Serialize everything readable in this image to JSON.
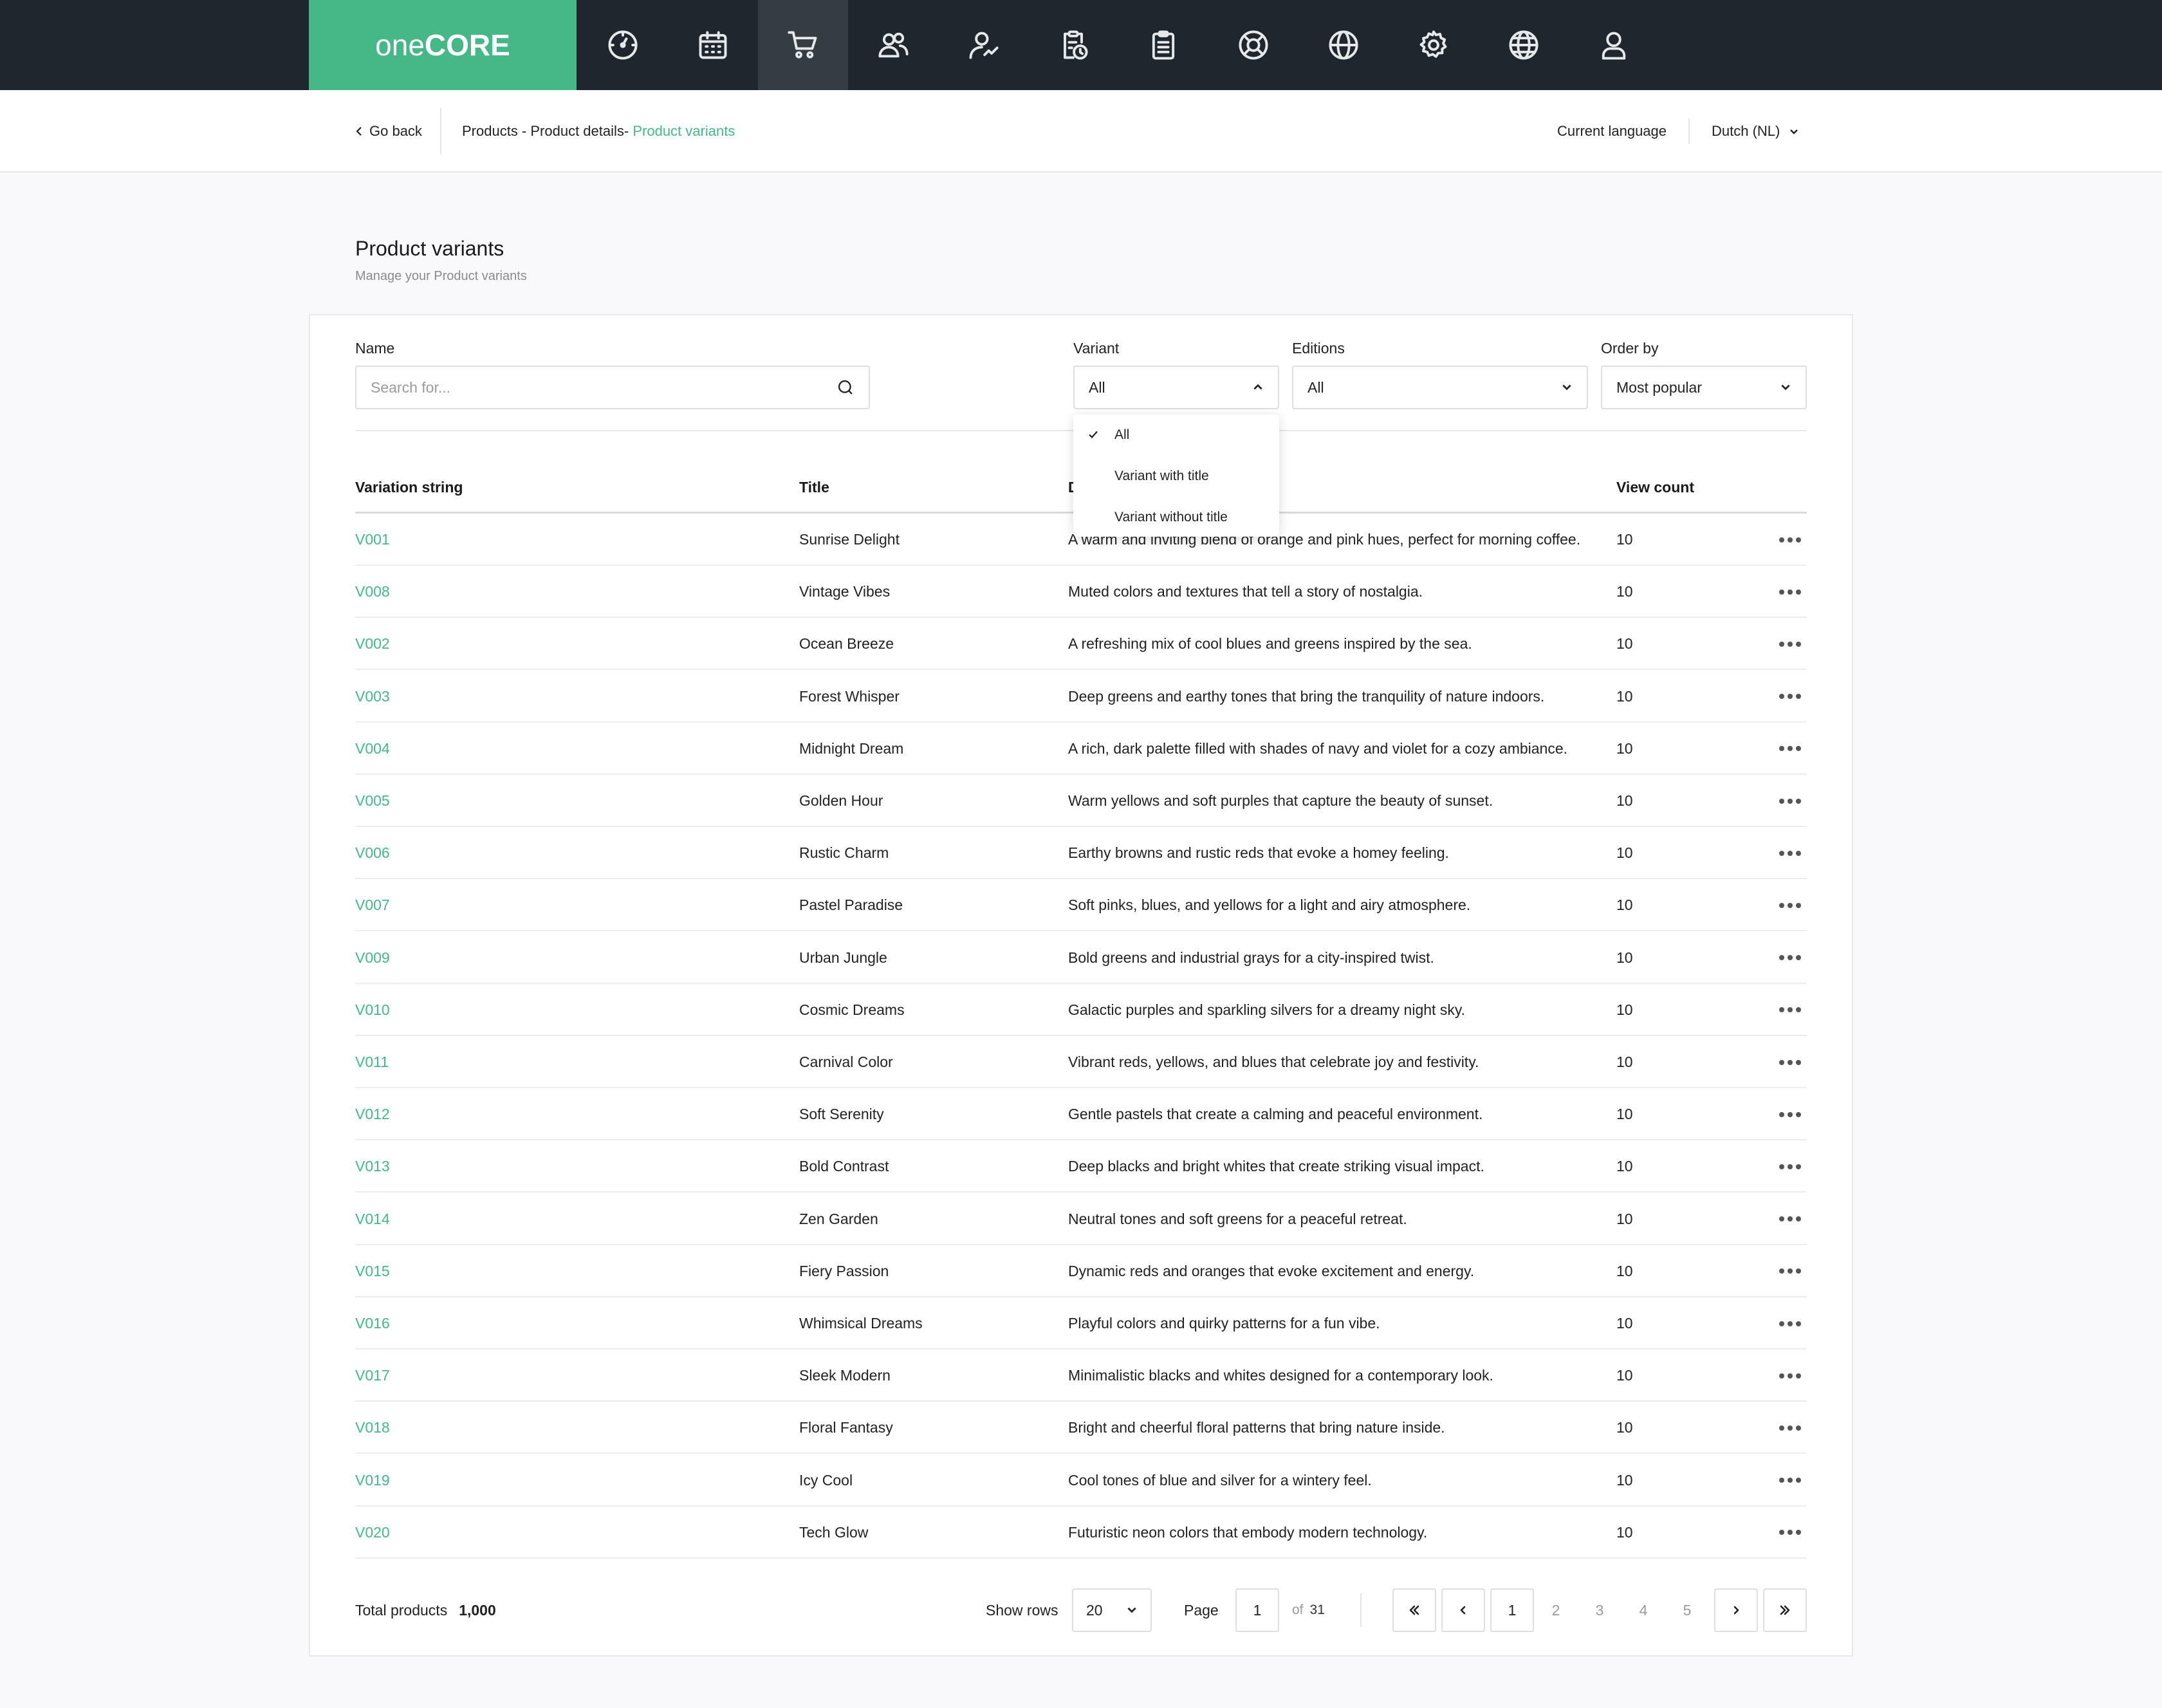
{
  "logo": {
    "prefix": "one",
    "suffix": "CORE"
  },
  "nav": {
    "icons": [
      "dashboard-icon",
      "calendar-icon",
      "cart-icon",
      "users-icon",
      "user-chart-icon",
      "clipboard-clock-icon",
      "clipboard-icon",
      "support-icon",
      "globe-icon",
      "gear-icon",
      "globe-grid-icon",
      "user-icon"
    ],
    "active": "cart-icon"
  },
  "subheader": {
    "go_back": "Go back",
    "breadcrumb": {
      "part1": "Products - ",
      "part2": "Product details- ",
      "current": "Product variants"
    },
    "current_language_label": "Current language",
    "language_value": "Dutch (NL)"
  },
  "page": {
    "title": "Product variants",
    "subtitle": "Manage your Product variants"
  },
  "filters": {
    "name_label": "Name",
    "name_placeholder": "Search for...",
    "variant_label": "Variant",
    "variant_value": "All",
    "editions_label": "Editions",
    "editions_value": "All",
    "orderby_label": "Order by",
    "orderby_value": "Most popular"
  },
  "variant_menu": {
    "items": [
      "All",
      "Variant with title",
      "Variant without title"
    ],
    "selected": "All"
  },
  "table": {
    "headers": {
      "variation": "Variation string",
      "title": "Title",
      "description": "D",
      "views": "View count"
    },
    "rows": [
      {
        "code": "V001",
        "title": "Sunrise Delight",
        "description": "A warm and inviting blend of orange and pink hues, perfect for morning coffee.",
        "views": "10"
      },
      {
        "code": "V008",
        "title": "Vintage Vibes",
        "description": "Muted colors and textures that tell a story of nostalgia.",
        "views": "10"
      },
      {
        "code": "V002",
        "title": "Ocean Breeze",
        "description": "A refreshing mix of cool blues and greens inspired by the sea.",
        "views": "10"
      },
      {
        "code": "V003",
        "title": "Forest Whisper",
        "description": "Deep greens and earthy tones that bring the tranquility of nature indoors.",
        "views": "10"
      },
      {
        "code": "V004",
        "title": "Midnight Dream",
        "description": "A rich, dark palette filled with shades of navy and violet for a cozy ambiance.",
        "views": "10"
      },
      {
        "code": "V005",
        "title": "Golden Hour",
        "description": "Warm yellows and soft purples that capture the beauty of sunset.",
        "views": "10"
      },
      {
        "code": "V006",
        "title": "Rustic Charm",
        "description": "Earthy browns and rustic reds that evoke a homey feeling.",
        "views": "10"
      },
      {
        "code": "V007",
        "title": "Pastel Paradise",
        "description": "Soft pinks, blues, and yellows for a light and airy atmosphere.",
        "views": "10"
      },
      {
        "code": "V009",
        "title": "Urban Jungle",
        "description": "Bold greens and industrial grays for a city-inspired twist.",
        "views": "10"
      },
      {
        "code": "V010",
        "title": "Cosmic Dreams",
        "description": "Galactic purples and sparkling silvers for a dreamy night sky.",
        "views": "10"
      },
      {
        "code": "V011",
        "title": "Carnival Color",
        "description": "Vibrant reds, yellows, and blues that celebrate joy and festivity.",
        "views": "10"
      },
      {
        "code": "V012",
        "title": "Soft Serenity",
        "description": "Gentle pastels that create a calming and peaceful environment.",
        "views": "10"
      },
      {
        "code": "V013",
        "title": "Bold Contrast",
        "description": "Deep blacks and bright whites that create striking visual impact.",
        "views": "10"
      },
      {
        "code": "V014",
        "title": "Zen Garden",
        "description": "Neutral tones and soft greens for a peaceful retreat.",
        "views": "10"
      },
      {
        "code": "V015",
        "title": "Fiery Passion",
        "description": "Dynamic reds and oranges that evoke excitement and energy.",
        "views": "10"
      },
      {
        "code": "V016",
        "title": "Whimsical Dreams",
        "description": "Playful colors and quirky patterns for a fun vibe.",
        "views": "10"
      },
      {
        "code": "V017",
        "title": "Sleek Modern",
        "description": "Minimalistic blacks and whites designed for a contemporary look.",
        "views": "10"
      },
      {
        "code": "V018",
        "title": "Floral Fantasy",
        "description": "Bright and cheerful floral patterns that bring nature inside.",
        "views": "10"
      },
      {
        "code": "V019",
        "title": "Icy Cool",
        "description": "Cool tones of blue and silver for a wintery feel.",
        "views": "10"
      },
      {
        "code": "V020",
        "title": "Tech Glow",
        "description": "Futuristic neon colors that embody modern technology.",
        "views": "10"
      }
    ]
  },
  "footer": {
    "total_label": "Total products",
    "total_value": "1,000",
    "show_rows_label": "Show rows",
    "rows_value": "20",
    "page_label": "Page",
    "page_value": "1",
    "of_label": "of",
    "total_pages": "31",
    "current_page": "1",
    "pages": [
      "2",
      "3",
      "4",
      "5"
    ]
  },
  "colors": {
    "accent": "#46b888",
    "nav_bg": "#1f262e",
    "nav_active": "#353c44"
  }
}
